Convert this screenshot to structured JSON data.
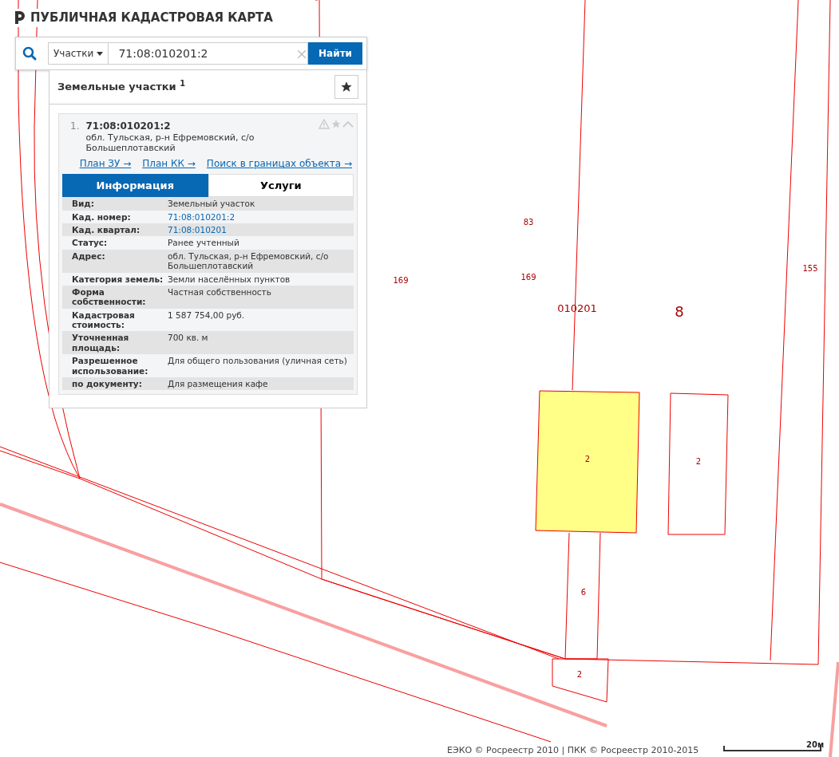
{
  "header": {
    "title": "ПУБЛИЧНАЯ КАДАСТРОВАЯ КАРТА"
  },
  "search": {
    "category": "Участки",
    "value": "71:08:010201:2",
    "button": "Найти"
  },
  "results": {
    "title": "Земельные участки",
    "count": "1",
    "items": [
      {
        "number": "1.",
        "cadastral": "71:08:010201:2",
        "address": "обл. Тульская, р-н Ефремовский, с/о Большеплотавский",
        "links": [
          "План ЗУ →",
          "План КК →",
          "Поиск в границах объекта →"
        ],
        "tabs": [
          {
            "label": "Информация",
            "selected": true
          },
          {
            "label": "Услуги",
            "selected": false
          }
        ],
        "rows": [
          {
            "label": "Вид:",
            "value": "Земельный участок",
            "link": false
          },
          {
            "label": "Кад. номер:",
            "value": "71:08:010201:2",
            "link": true
          },
          {
            "label": "Кад. квартал:",
            "value": "71:08:010201",
            "link": true
          },
          {
            "label": "Статус:",
            "value": "Ранее учтенный",
            "link": false
          },
          {
            "label": "Адрес:",
            "value": "обл. Тульская, р-н Ефремовский, с/о Большеплотавский",
            "link": false
          },
          {
            "label": "Категория земель:",
            "value": "Земли населённых пунктов",
            "link": false
          },
          {
            "label": "Форма собственности:",
            "value": "Частная собственность",
            "link": false
          },
          {
            "label": "Кадастровая стоимость:",
            "value": "1 587 754,00 руб.",
            "link": false
          },
          {
            "label": "Уточненная площадь:",
            "value": "700 кв. м",
            "link": false
          },
          {
            "label": "Разрешенное использование:",
            "value": "Для общего пользования (уличная сеть)",
            "link": false
          },
          {
            "label": "по документу:",
            "value": "Для размещения кафе",
            "link": false
          }
        ]
      }
    ]
  },
  "map": {
    "labels": [
      "83",
      "169",
      "169",
      "155",
      "010201",
      "8",
      "2",
      "2",
      "6",
      "2"
    ]
  },
  "footer": {
    "attribution": "ЕЭКО © Росреестр 2010 | ПКК © Росреестр 2010-2015",
    "scale": "20м"
  }
}
